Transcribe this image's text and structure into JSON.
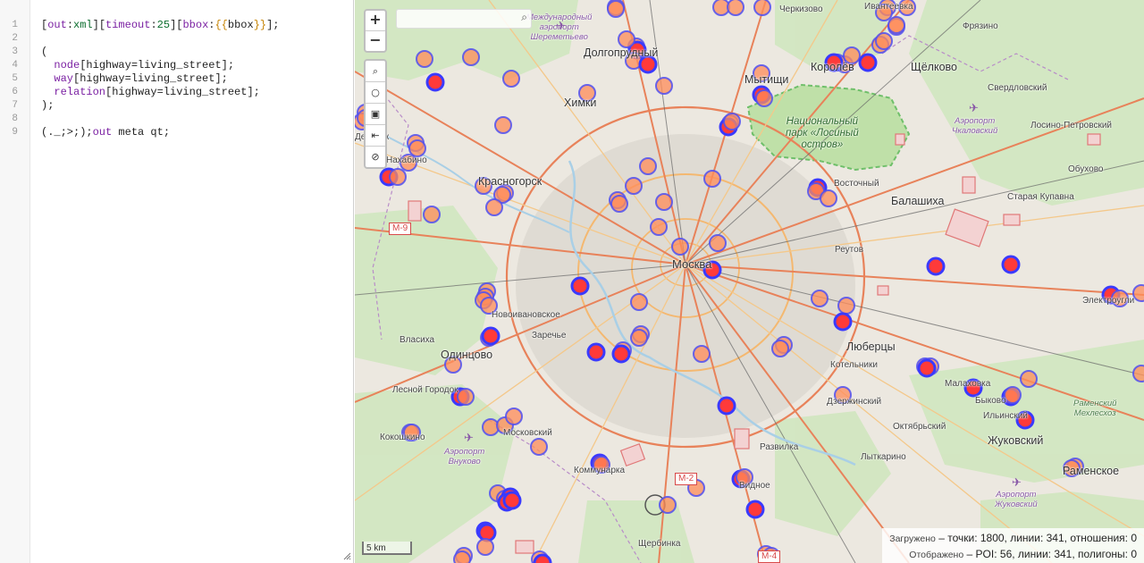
{
  "editor": {
    "line_numbers": [
      "1",
      "2",
      "3",
      "4",
      "5",
      "6",
      "7",
      "8",
      "9"
    ],
    "lines": [
      [
        {
          "t": "[",
          "c": ""
        },
        {
          "t": "out",
          "c": "k"
        },
        {
          "t": ":",
          "c": ""
        },
        {
          "t": "xml",
          "c": "a"
        },
        {
          "t": "][",
          "c": ""
        },
        {
          "t": "timeout",
          "c": "k"
        },
        {
          "t": ":",
          "c": ""
        },
        {
          "t": "25",
          "c": "a"
        },
        {
          "t": "][",
          "c": ""
        },
        {
          "t": "bbox",
          "c": "k"
        },
        {
          "t": ":",
          "c": ""
        },
        {
          "t": "{{",
          "c": "b"
        },
        {
          "t": "bbox",
          "c": ""
        },
        {
          "t": "}}",
          "c": "b"
        },
        {
          "t": "];",
          "c": ""
        }
      ],
      [],
      [
        {
          "t": "(",
          "c": ""
        }
      ],
      [
        {
          "t": "  node",
          "c": "k"
        },
        {
          "t": "[highway=living_street];",
          "c": ""
        }
      ],
      [
        {
          "t": "  way",
          "c": "k"
        },
        {
          "t": "[highway=living_street];",
          "c": ""
        }
      ],
      [
        {
          "t": "  relation",
          "c": "k"
        },
        {
          "t": "[highway=living_street];",
          "c": ""
        }
      ],
      [
        {
          "t": ");",
          "c": ""
        }
      ],
      [],
      [
        {
          "t": "(._;>;);",
          "c": ""
        },
        {
          "t": "out",
          "c": "k"
        },
        {
          "t": " meta qt;",
          "c": ""
        }
      ]
    ]
  },
  "map": {
    "zoom_in": "+",
    "zoom_out": "−",
    "tool_icons": [
      "zoom-to-data-icon",
      "locate-icon",
      "map-layers-icon",
      "fit-data-icon",
      "clear-data-icon"
    ],
    "tool_glyphs": [
      "⌕",
      "○",
      "▣",
      "⇤",
      "⊘"
    ],
    "search_glyph": "⌕",
    "scale": "5 km",
    "airports": [
      {
        "name": "airport-sheremetyevo",
        "label": "Международный\nаэропорт\nШереметьево"
      },
      {
        "name": "airport-chkalovsky",
        "label": "Аэропорт\nЧкаловский"
      },
      {
        "name": "airport-vnukovo",
        "label": "Аэропорт\nВнуково"
      },
      {
        "name": "airport-zhukovsky",
        "label": "Аэропорт\nЖуковский"
      }
    ],
    "park": "Национальный\nпарк «Лосиный\nостров»",
    "cities": [
      {
        "n": "moscow",
        "t": "Москва",
        "c": "p-big"
      },
      {
        "n": "dolgoprudny",
        "t": "Долгопрудный",
        "c": "p-med"
      },
      {
        "n": "mytishchi",
        "t": "Мытищи",
        "c": "p-med"
      },
      {
        "n": "khimki",
        "t": "Химки",
        "c": "p-med"
      },
      {
        "n": "korolev",
        "t": "Королёв",
        "c": "p-med"
      },
      {
        "n": "shchyolkovo",
        "t": "Щёлково",
        "c": "p-med"
      },
      {
        "n": "krasnogorsk",
        "t": "Красногорск",
        "c": "p-med"
      },
      {
        "n": "balashikha",
        "t": "Балашиха",
        "c": "p-med"
      },
      {
        "n": "odintsovo",
        "t": "Одинцово",
        "c": "p-med"
      },
      {
        "n": "lyubertsy",
        "t": "Люберцы",
        "c": "p-med"
      },
      {
        "n": "zhukovsky",
        "t": "Жуковский",
        "c": "p-med"
      },
      {
        "n": "ramenskoye",
        "t": "Раменское",
        "c": "p-med"
      }
    ],
    "towns": [
      {
        "n": "cherkizovo",
        "t": "Черкизово"
      },
      {
        "n": "ivanteevka",
        "t": "Ивантеевка"
      },
      {
        "n": "fryazino",
        "t": "Фрязино"
      },
      {
        "n": "sverdlovsky",
        "t": "Свердловский"
      },
      {
        "n": "losino-petrovsky",
        "t": "Лосино-Петровский"
      },
      {
        "n": "obukhovo",
        "t": "Обухово"
      },
      {
        "n": "nakhabino",
        "t": "Нахабино"
      },
      {
        "n": "dedovsk",
        "t": "Дедовск"
      },
      {
        "n": "vostochny",
        "t": "Восточный"
      },
      {
        "n": "staraya-kupavna",
        "t": "Старая Купавна"
      },
      {
        "n": "reutov",
        "t": "Реутов"
      },
      {
        "n": "elektrougli",
        "t": "Электроугли"
      },
      {
        "n": "novoivanovskoye",
        "t": "Новоивановское"
      },
      {
        "n": "zarechye",
        "t": "Заречье"
      },
      {
        "n": "vlasikha",
        "t": "Власиха"
      },
      {
        "n": "kotelniki",
        "t": "Котельники"
      },
      {
        "n": "malakhovka",
        "t": "Малаховка"
      },
      {
        "n": "lesnoy-gorodok",
        "t": "Лесной Городок"
      },
      {
        "n": "dzerzhinsky",
        "t": "Дзержинский"
      },
      {
        "n": "bykovo",
        "t": "Быково"
      },
      {
        "n": "ilyinsky",
        "t": "Ильинский"
      },
      {
        "n": "kokoshkino",
        "t": "Кокошкино"
      },
      {
        "n": "moskovsky",
        "t": "Московский"
      },
      {
        "n": "oktyabrsky",
        "t": "Октябрьский"
      },
      {
        "n": "razvilka",
        "t": "Развилка"
      },
      {
        "n": "lytkarino",
        "t": "Лыткарино"
      },
      {
        "n": "kommunarka",
        "t": "Коммунарка"
      },
      {
        "n": "vidnoye",
        "t": "Видное"
      },
      {
        "n": "shcherbinka",
        "t": "Щербинка"
      }
    ],
    "mehlhose": "Раменский\nМехлесхоз",
    "roads": [
      "M-9",
      "M-2",
      "M-4"
    ],
    "stats": {
      "loaded_label": "Загружено",
      "loaded_value": "– точки: 1800, линии: 341, отношения: 0",
      "shown_label": "Отображено",
      "shown_value": "– POI: 56, линии: 341, полигоны: 0"
    }
  }
}
